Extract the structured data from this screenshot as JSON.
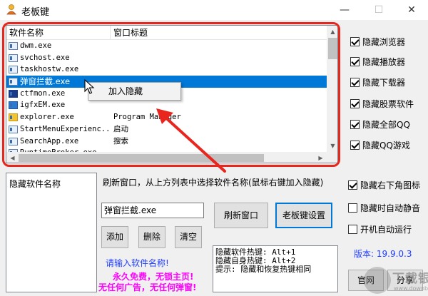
{
  "window": {
    "title": "老板键",
    "minimize_glyph": "—",
    "maximize_glyph": "☐",
    "close_glyph": "✕"
  },
  "process_list": {
    "columns": [
      "软件名称",
      "窗口标题"
    ],
    "rows": [
      {
        "name": "dwm.exe",
        "title": ""
      },
      {
        "name": "svchost.exe",
        "title": ""
      },
      {
        "name": "taskhostw.exe",
        "title": ""
      },
      {
        "name": "弹窗拦截.exe",
        "title": "",
        "selected": true
      },
      {
        "name": "ctfmon.exe",
        "title": ""
      },
      {
        "name": "igfxEM.exe",
        "title": ""
      },
      {
        "name": "explorer.exe",
        "title": "Program Manager"
      },
      {
        "name": "StartMenuExperienc...",
        "title": "启动"
      },
      {
        "name": "SearchApp.exe",
        "title": "搜索"
      },
      {
        "name": "RuntimeBroker.exe",
        "title": ""
      }
    ]
  },
  "context_menu": {
    "item": "加入隐藏"
  },
  "options_right": [
    {
      "label": "隐藏浏览器",
      "checked": true
    },
    {
      "label": "隐藏播放器",
      "checked": true
    },
    {
      "label": "隐藏下载器",
      "checked": true
    },
    {
      "label": "隐藏股票软件",
      "checked": true
    },
    {
      "label": "隐藏全部QQ",
      "checked": true
    },
    {
      "label": "隐藏QQ游戏",
      "checked": true
    }
  ],
  "options_bottom": [
    {
      "label": "隐藏右下角图标",
      "checked": true
    },
    {
      "label": "隐藏时自动静音",
      "checked": false
    },
    {
      "label": "开机自动运行",
      "checked": false
    }
  ],
  "hidden_list": {
    "header": "隐藏软件名称"
  },
  "instruction": "刷新窗口，从上方列表中选择软件名称(鼠标右键加入隐藏)",
  "name_input": {
    "value": "弹窗拦截.exe"
  },
  "buttons": {
    "refresh": "刷新窗口",
    "boss_key_settings": "老板键设置",
    "add": "添加",
    "delete": "删除",
    "clear": "清空",
    "website": "官网",
    "share": "分享"
  },
  "hint": "请输入软件名称!",
  "promo_line1": "永久免费，无锁主页!",
  "promo_line2": "无任何广告，无任何弹窗!",
  "hotkeys": [
    "隐藏软件热键: Alt+1",
    "隐藏自身热键: Alt+2",
    "提示: 隐藏和恢复热键相同"
  ],
  "version": "版本: 19.9.0.3",
  "watermark": {
    "text": "下载银行",
    "sub": "www.downbank.cn"
  },
  "colors": {
    "annotation_red": "#e8261e",
    "selection_blue": "#0078d7",
    "hint_blue": "#1e3cff",
    "promo_magenta": "#ff00ff"
  }
}
